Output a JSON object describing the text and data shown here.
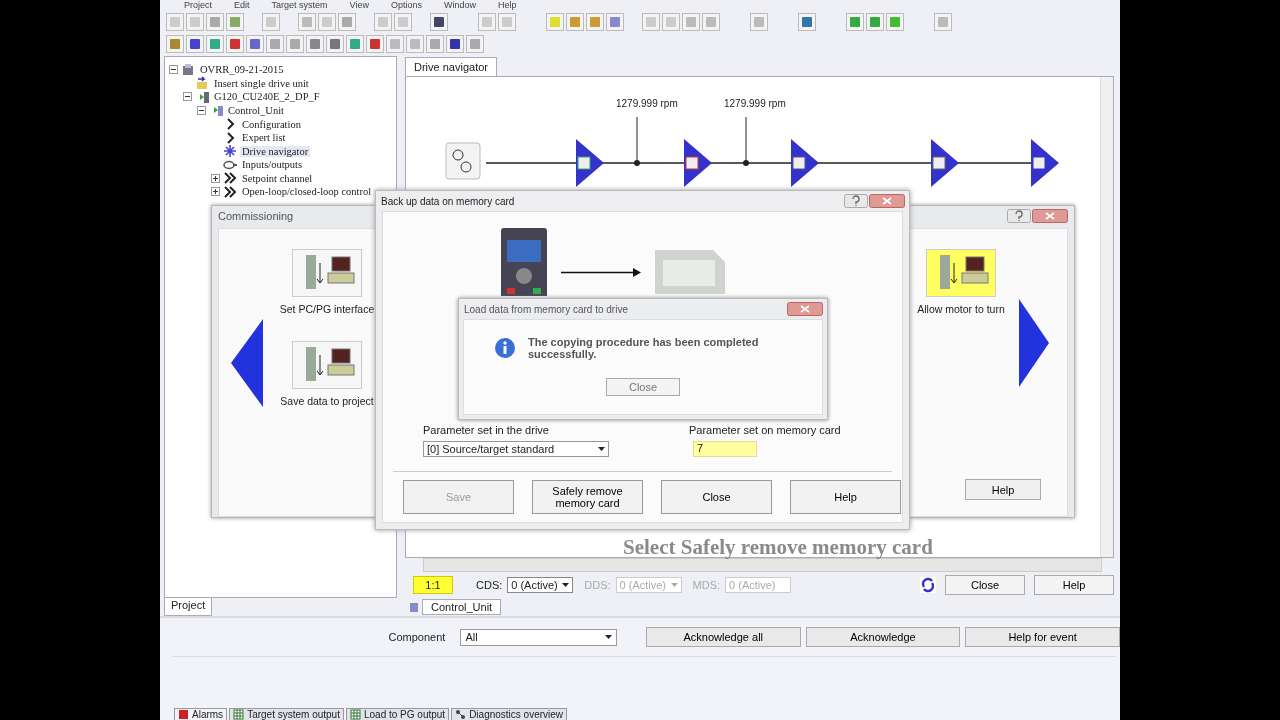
{
  "menu": [
    "Project",
    "Edit",
    "Target system",
    "View",
    "Options",
    "Window",
    "Help"
  ],
  "project_tree": {
    "items": [
      {
        "label": "OVRR_09-21-2015",
        "kind": "project",
        "expanded": true,
        "selected": false,
        "children": [
          {
            "label": "Insert single drive unit",
            "kind": "action",
            "selected": false
          },
          {
            "label": "G120_CU240E_2_DP_F",
            "kind": "drive",
            "expanded": true,
            "selected": false,
            "children": [
              {
                "label": "Control_Unit",
                "kind": "unit",
                "expanded": true,
                "selected": false,
                "children": [
                  {
                    "label": "Configuration",
                    "kind": "function",
                    "selected": false
                  },
                  {
                    "label": "Expert list",
                    "kind": "function",
                    "selected": false
                  },
                  {
                    "label": "Drive navigator",
                    "kind": "navigator",
                    "selected": true
                  },
                  {
                    "label": "Inputs/outputs",
                    "kind": "io",
                    "selected": false
                  },
                  {
                    "label": "Setpoint channel",
                    "kind": "group",
                    "expanded": false,
                    "selected": false
                  },
                  {
                    "label": "Open-loop/closed-loop control",
                    "kind": "group",
                    "expanded": false,
                    "selected": false
                  }
                ]
              }
            ]
          }
        ]
      }
    ]
  },
  "project_tabs": [
    {
      "label": "Project",
      "selected": true
    }
  ],
  "workspace_tabs": [
    {
      "label": "Drive navigator",
      "selected": true
    }
  ],
  "drive_navigator": {
    "speed_readings": [
      "1279.999 rpm",
      "1279.999 rpm"
    ]
  },
  "status_row": {
    "ratio": "1:1",
    "selectors": [
      {
        "label": "CDS:",
        "value": "0 (Active)",
        "disabled": false,
        "kind": "dropdown"
      },
      {
        "label": "DDS:",
        "value": "0 (Active)",
        "disabled": true,
        "kind": "dropdown"
      },
      {
        "label": "MDS:",
        "value": "0 (Active)",
        "disabled": true,
        "kind": "field"
      }
    ],
    "buttons": [
      "Close",
      "Help"
    ]
  },
  "object_tabs": [
    {
      "label": "Control_Unit",
      "selected": true
    }
  ],
  "detail_view": {
    "component_label": "Component",
    "component_value": "All",
    "buttons": [
      "Acknowledge all",
      "Acknowledge",
      "Help for event"
    ],
    "tabs": [
      {
        "label": "Alarms",
        "kind": "alarms",
        "selected": true
      },
      {
        "label": "Target system output",
        "kind": "table",
        "selected": false
      },
      {
        "label": "Load to PG output",
        "kind": "table",
        "selected": false
      },
      {
        "label": "Diagnostics overview",
        "kind": "diagnostics",
        "selected": false
      }
    ]
  },
  "commissioning_dialog": {
    "title": "Commissioning",
    "left_steps": [
      {
        "label": "Set PC/PG interface",
        "highlighted": false
      },
      {
        "label": "Save data to project",
        "highlighted": false
      }
    ],
    "right_steps": [
      {
        "label": "Allow motor to turn",
        "highlighted": true
      }
    ],
    "buttons": [
      "Help"
    ]
  },
  "backup_dialog": {
    "title": "Back up data on memory card",
    "drive_parameter_label": "Parameter set in the drive",
    "drive_parameter_value": "[0] Source/target standard",
    "card_parameter_label": "Parameter set on memory card",
    "card_parameter_value": "7",
    "buttons": [
      {
        "label": "Save",
        "disabled": true
      },
      {
        "label": "Safely remove memory card",
        "disabled": false
      },
      {
        "label": "Close",
        "disabled": false
      },
      {
        "label": "Help",
        "disabled": false
      }
    ]
  },
  "message_box": {
    "title": "Load data from memory card to drive",
    "message": "The copying procedure has been completed successfully.",
    "button": "Close"
  },
  "caption": "Select Safely remove memory card"
}
